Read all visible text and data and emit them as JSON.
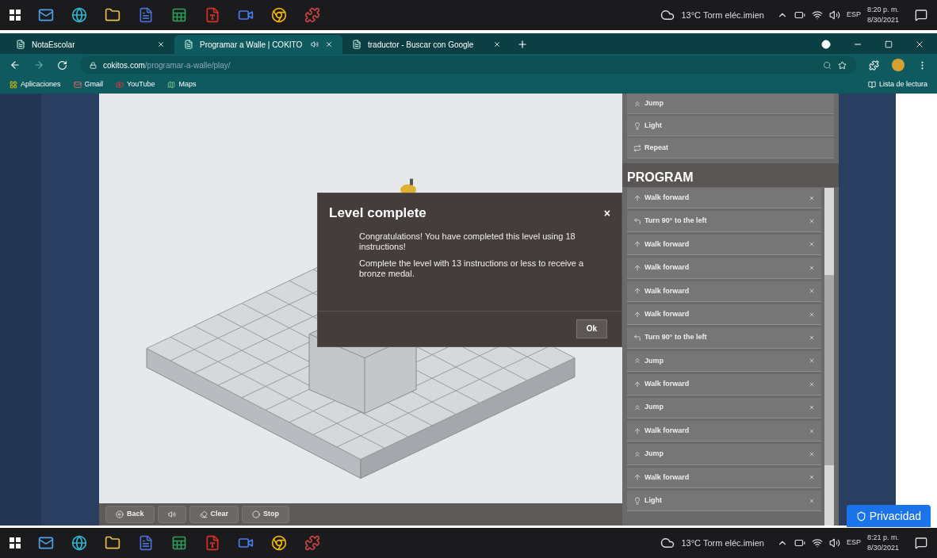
{
  "taskbar_top": {
    "weather": "13°C  Torm eléc.imien",
    "language": "ESP",
    "time": "8:20 p. m.",
    "date": "8/30/2021"
  },
  "browser": {
    "tabs": [
      {
        "label": "NotaEscolar",
        "selected": false
      },
      {
        "label": "Programar a Walle | COKITO",
        "selected": true
      },
      {
        "label": "traductor - Buscar con Google",
        "selected": false
      }
    ],
    "address": {
      "domain": "cokitos.com",
      "path": "/programar-a-walle/play/"
    },
    "bookmarks": [
      "Aplicaciones",
      "Gmail",
      "YouTube",
      "Maps"
    ],
    "reading_list": "Lista de lectura"
  },
  "game": {
    "commands": [
      {
        "label": "Jump",
        "kind": "jump"
      },
      {
        "label": "Light",
        "kind": "light"
      },
      {
        "label": "Repeat",
        "kind": "repeat"
      }
    ],
    "program_title": "PROGRAM",
    "program": [
      {
        "label": "Walk forward",
        "kind": "walk"
      },
      {
        "label": "Turn 90° to the left",
        "kind": "turn"
      },
      {
        "label": "Walk forward",
        "kind": "walk"
      },
      {
        "label": "Walk forward",
        "kind": "walk"
      },
      {
        "label": "Walk forward",
        "kind": "walk"
      },
      {
        "label": "Walk forward",
        "kind": "walk"
      },
      {
        "label": "Turn 90° to the left",
        "kind": "turn"
      },
      {
        "label": "Jump",
        "kind": "jump"
      },
      {
        "label": "Walk forward",
        "kind": "walk"
      },
      {
        "label": "Jump",
        "kind": "jump"
      },
      {
        "label": "Walk forward",
        "kind": "walk"
      },
      {
        "label": "Jump",
        "kind": "jump"
      },
      {
        "label": "Walk forward",
        "kind": "walk"
      },
      {
        "label": "Light",
        "kind": "light"
      }
    ],
    "toolbar": [
      {
        "label": "Back",
        "kind": "back"
      },
      {
        "kind": "sound"
      },
      {
        "label": "Clear",
        "kind": "clear"
      },
      {
        "label": "Stop",
        "kind": "stop"
      }
    ]
  },
  "dialog": {
    "title": "Level complete",
    "close": "×",
    "paragraphs": [
      "Congratulations! You have completed this level using 18 instructions!",
      "Complete the level with 13 instructions or less to receive a bronze medal."
    ],
    "button": "Ok"
  },
  "privacy_button": "Privacidad",
  "taskbar_bottom": {
    "weather": "13°C  Torm eléc.imien",
    "language": "ESP",
    "time": "8:21 p. m.",
    "date": "8/30/2021"
  }
}
